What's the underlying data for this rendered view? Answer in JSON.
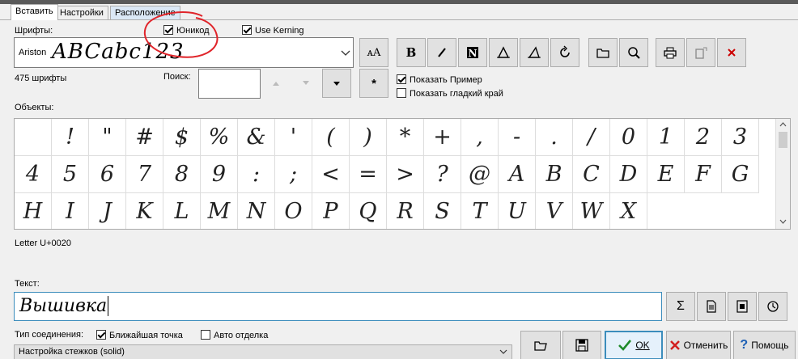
{
  "tabs": [
    {
      "label": "Вставить",
      "active": true
    },
    {
      "label": "Настройки",
      "active": false
    },
    {
      "label": "Расположение",
      "active": false
    }
  ],
  "fonts": {
    "label": "Шрифты:",
    "selected_name": "Ariston",
    "preview": "ABCabc123",
    "count": "475 шрифты"
  },
  "options": {
    "unicode_label": "Юникод",
    "unicode_checked": true,
    "kerning_label": "Use Kerning",
    "kerning_checked": true,
    "show_sample_label": "Показать Пример",
    "show_sample_checked": true,
    "smooth_edge_label": "Показать гладкий край",
    "smooth_edge_checked": false
  },
  "search": {
    "label": "Поиск:",
    "value": ""
  },
  "toolbar": {
    "asterisk": "*",
    "icons": [
      "font-size-icon",
      "bold-icon",
      "italic-icon",
      "n-box-icon",
      "slant-left-icon",
      "slant-right-icon",
      "rotate-icon",
      "folder-icon",
      "zoom-icon",
      "print-icon",
      "export-icon",
      "cancel-icon"
    ]
  },
  "objects": {
    "label": "Объекты:",
    "glyphs": [
      " ",
      "!",
      "\"",
      "#",
      "$",
      "%",
      "&",
      "'",
      "(",
      ")",
      "*",
      "+",
      ",",
      "-",
      ".",
      "/",
      "0",
      "1",
      "2",
      "3",
      "4",
      "5",
      "6",
      "7",
      "8",
      "9",
      ":",
      ";",
      "<",
      "=",
      ">",
      "?",
      "@",
      "A",
      "B",
      "C",
      "D",
      "E",
      "F",
      "G",
      "H",
      "I",
      "J",
      "K",
      "L",
      "M",
      "N",
      "O",
      "P",
      "Q",
      "R",
      "S",
      "T",
      "U",
      "V",
      "W",
      "X"
    ]
  },
  "letter_info": "Letter U+0020",
  "text": {
    "label": "Текст:",
    "value": "Вышивка"
  },
  "side_buttons": {
    "sigma": "Σ"
  },
  "connection": {
    "label": "Тип соединения:",
    "nearest_label": "Ближайшая точка",
    "nearest_checked": true,
    "auto_label": "Авто отделка",
    "auto_checked": false
  },
  "stitch_select": "Настройка стежков (solid)",
  "bottom": {
    "ok": "OK",
    "cancel": "Отменить",
    "help": "Помощь"
  },
  "colors": {
    "annotation": "#e0242a",
    "accent": "#3c8dbc"
  }
}
